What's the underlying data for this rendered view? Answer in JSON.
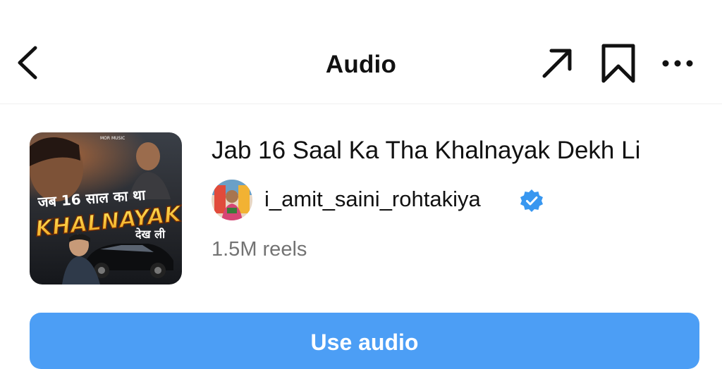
{
  "header": {
    "title": "Audio",
    "back_icon": "chevron-left-icon",
    "share_icon": "share-arrow-icon",
    "save_icon": "bookmark-icon",
    "more_icon": "more-horizontal-icon"
  },
  "audio": {
    "title": "Jab 16 Saal Ka Tha Khalnayak Dekh Li",
    "artist": "i_amit_saini_rohtakiya",
    "artist_verified": true,
    "reels_count": "1.5M reels",
    "cover_art": {
      "line1": "जब 16 साल का था",
      "line2": "KHALNAYAK",
      "line3": "देख ली",
      "label": "MOR MUSIC"
    }
  },
  "actions": {
    "use_audio_label": "Use audio"
  },
  "colors": {
    "accent": "#4c9ef5",
    "verified": "#3897f0",
    "secondary_text": "#737373"
  }
}
